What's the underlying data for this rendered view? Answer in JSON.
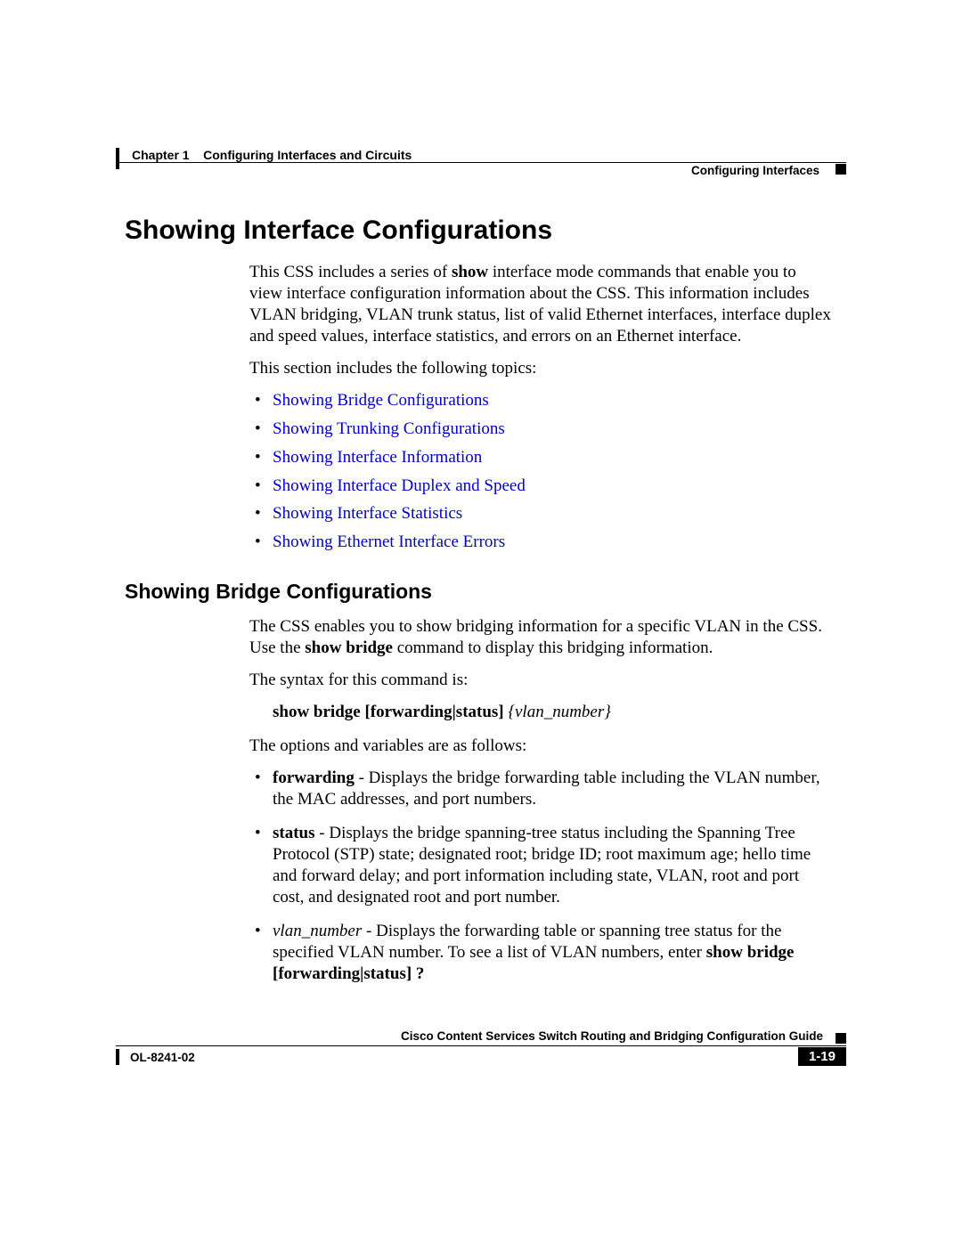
{
  "header": {
    "chapter_label": "Chapter 1",
    "chapter_title": "Configuring Interfaces and Circuits",
    "section": "Configuring Interfaces"
  },
  "h1": "Showing Interface Configurations",
  "intro_p1_a": "This CSS includes a series of ",
  "intro_p1_b": "show",
  "intro_p1_c": " interface mode commands that enable you to view interface configuration information about the CSS. This information includes VLAN bridging, VLAN trunk status, list of valid Ethernet interfaces, interface duplex and speed values, interface statistics, and errors on an Ethernet interface.",
  "intro_p2": "This section includes the following topics:",
  "links": [
    "Showing Bridge Configurations",
    "Showing Trunking Configurations",
    "Showing Interface Information",
    "Showing Interface Duplex and Speed",
    "Showing Interface Statistics",
    "Showing Ethernet Interface Errors"
  ],
  "h2": "Showing Bridge Configurations",
  "bridge_p1_a": "The CSS enables you to show bridging information for a specific VLAN in the CSS. Use the ",
  "bridge_p1_b": "show bridge",
  "bridge_p1_c": " command to display this bridging information.",
  "bridge_p2": "The syntax for this command is:",
  "syntax_bold": "show bridge [forwarding|status]",
  "syntax_ital": " {vlan_number}",
  "bridge_p3": "The options and variables are as follows:",
  "opts": {
    "o1_b": "forwarding",
    "o1_t": " - Displays the bridge forwarding table including the VLAN number, the MAC addresses, and port numbers.",
    "o2_b": "status",
    "o2_t": " - Displays the bridge spanning-tree status including the Spanning Tree Protocol (STP) state; designated root; bridge ID; root maximum age; hello time and forward delay; and port information including state, VLAN, root and port cost, and designated root and port number.",
    "o3_i": "vlan_number",
    "o3_t1": " - Displays the forwarding table or spanning tree status for the specified VLAN number. To see a list of VLAN numbers, enter ",
    "o3_b1": "show bridge",
    "o3_b2": "[forwarding|status] ?"
  },
  "footer": {
    "guide": "Cisco Content Services Switch Routing and Bridging Configuration Guide",
    "doc": "OL-8241-02",
    "page": "1-19"
  }
}
